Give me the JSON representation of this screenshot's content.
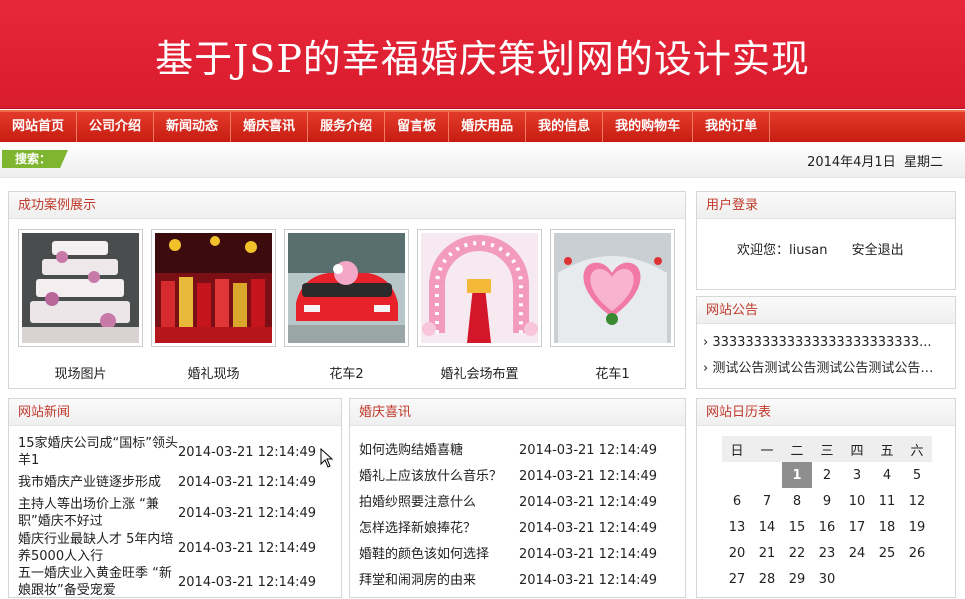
{
  "site_title": "基于JSP的幸福婚庆策划网的设计实现",
  "nav": [
    "网站首页",
    "公司介绍",
    "新闻动态",
    "婚庆喜讯",
    "服务介绍",
    "留言板",
    "婚庆用品",
    "我的信息",
    "我的购物车",
    "我的订单"
  ],
  "search_label": "搜索：",
  "date_text": "2014年4月1日",
  "weekday_text": "星期二",
  "cases": {
    "title": "成功案例展示",
    "items": [
      "现场图片",
      "婚礼现场",
      "花车2",
      "婚礼会场布置",
      "花车1"
    ]
  },
  "news": {
    "title": "网站新闻",
    "rows": [
      {
        "title": "15家婚庆公司成“国标”领头羊1",
        "date": "2014-03-21 12:14:49"
      },
      {
        "title": "我市婚庆产业链逐步形成",
        "date": "2014-03-21 12:14:49"
      },
      {
        "title": "主持人等出场价上涨 “兼职”婚庆不好过",
        "date": "2014-03-21 12:14:49"
      },
      {
        "title": "婚庆行业最缺人才 5年内培养5000人入行",
        "date": "2014-03-21 12:14:49"
      },
      {
        "title": "五一婚庆业入黄金旺季 “新娘跟妆”备受宠爱",
        "date": "2014-03-21 12:14:49"
      }
    ]
  },
  "xixun": {
    "title": "婚庆喜讯",
    "rows": [
      {
        "title": "如何选购结婚喜糖",
        "date": "2014-03-21 12:14:49"
      },
      {
        "title": "婚礼上应该放什么音乐？",
        "date": "2014-03-21 12:14:49"
      },
      {
        "title": "拍婚纱照要注意什么",
        "date": "2014-03-21 12:14:49"
      },
      {
        "title": "怎样选择新娘捧花？",
        "date": "2014-03-21 12:14:49"
      },
      {
        "title": "婚鞋的颜色该如何选择",
        "date": "2014-03-21 12:14:49"
      },
      {
        "title": "拜堂和闹洞房的由来",
        "date": "2014-03-21 12:14:49"
      }
    ]
  },
  "login": {
    "title": "用户登录",
    "welcome": "欢迎您：liusan",
    "logout": "安全退出"
  },
  "notice": {
    "title": "网站公告",
    "items": [
      "› 3333333333333333333333333...",
      "› 测试公告测试公告测试公告测试公告…"
    ]
  },
  "calendar": {
    "title": "网站日历表",
    "headers": [
      "日",
      "一",
      "二",
      "三",
      "四",
      "五",
      "六"
    ],
    "weeks": [
      [
        "",
        "",
        "1",
        "2",
        "3",
        "4",
        "5"
      ],
      [
        "6",
        "7",
        "8",
        "9",
        "10",
        "11",
        "12"
      ],
      [
        "13",
        "14",
        "15",
        "16",
        "17",
        "18",
        "19"
      ],
      [
        "20",
        "21",
        "22",
        "23",
        "24",
        "25",
        "26"
      ],
      [
        "27",
        "28",
        "29",
        "30",
        "",
        "",
        ""
      ]
    ],
    "today": "1"
  }
}
